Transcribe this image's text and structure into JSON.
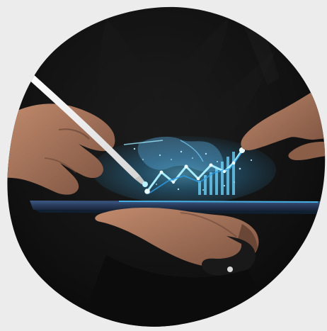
{
  "image": {
    "subject": "hands-with-stylus-and-tablet-holographic-chart-icon",
    "background_color": "#ececec",
    "shirt_color": "#111111",
    "tablet_color": "#2a3c5c",
    "glow_color": "#38b8ff",
    "skin_color": "#a77458"
  }
}
